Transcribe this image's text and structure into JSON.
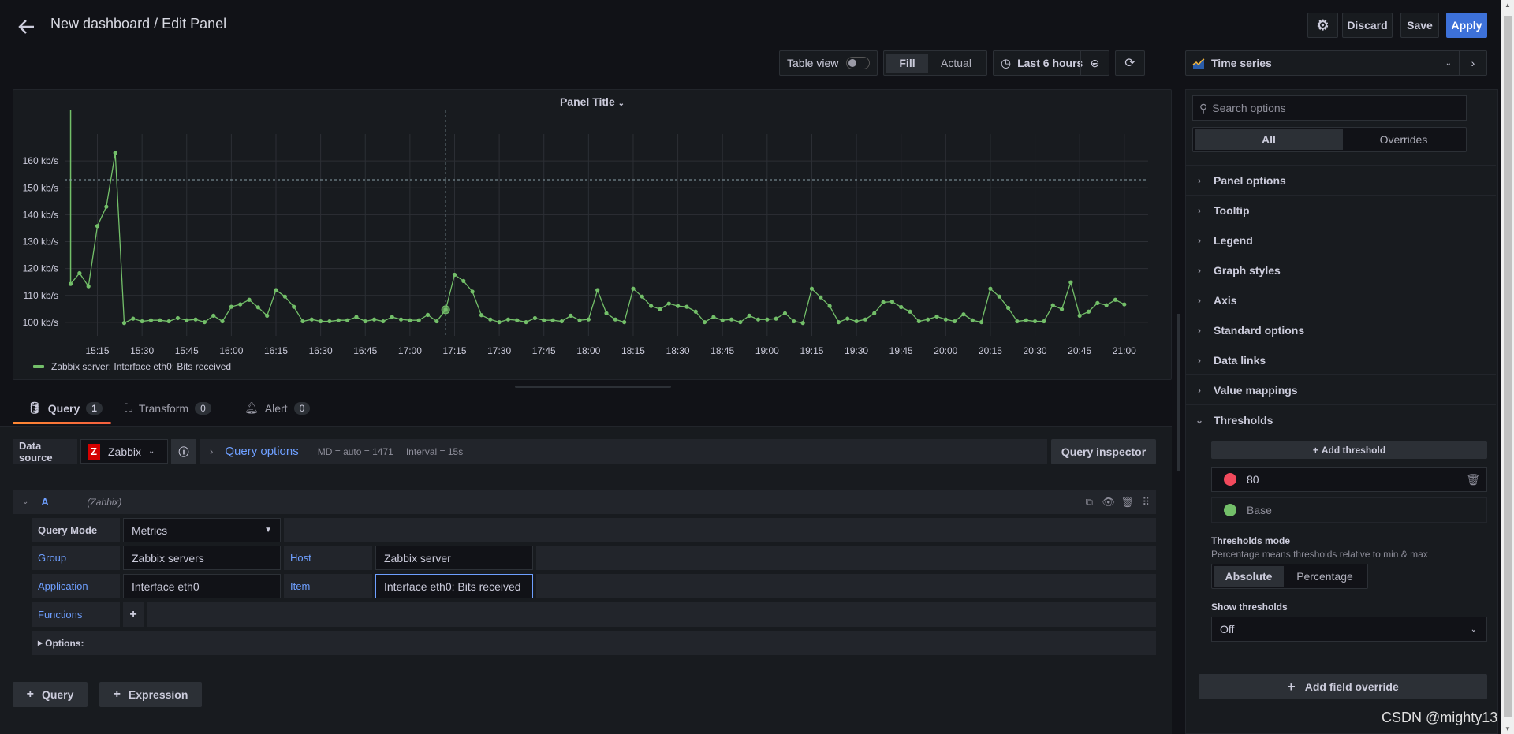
{
  "header": {
    "title": "New dashboard / Edit Panel",
    "discard": "Discard",
    "save": "Save",
    "apply": "Apply"
  },
  "toolbar": {
    "table_view": "Table view",
    "table_view_on": false,
    "fill": "Fill",
    "actual": "Actual",
    "time_range": "Last 6 hours",
    "visualization": "Time series"
  },
  "panel": {
    "title": "Panel Title",
    "legend": "Zabbix server: Interface eth0: Bits received"
  },
  "chart_data": {
    "type": "line",
    "ylim": [
      95,
      170
    ],
    "xlim": [
      "15:04",
      "21:08"
    ],
    "y_ticks": [
      "100 kb/s",
      "110 kb/s",
      "120 kb/s",
      "130 kb/s",
      "140 kb/s",
      "150 kb/s",
      "160 kb/s"
    ],
    "y_tick_values": [
      100,
      110,
      120,
      130,
      140,
      150,
      160
    ],
    "x_ticks": [
      "15:15",
      "15:30",
      "15:45",
      "16:00",
      "16:15",
      "16:30",
      "16:45",
      "17:00",
      "17:15",
      "17:30",
      "17:45",
      "18:00",
      "18:15",
      "18:30",
      "18:45",
      "19:00",
      "19:15",
      "19:30",
      "19:45",
      "20:00",
      "20:15",
      "20:30",
      "20:45",
      "21:00"
    ],
    "grid": true,
    "legend_placement": "bottom-left",
    "series_color": "#73bf69",
    "hover": {
      "x": "17:12",
      "y": 153
    },
    "series": [
      {
        "name": "Zabbix server: Interface eth0: Bits received",
        "unit": "kb/s",
        "points": [
          [
            "15:06",
            114.3
          ],
          [
            "15:09",
            118.3
          ],
          [
            "15:12",
            113.4
          ],
          [
            "15:15",
            135.8
          ],
          [
            "15:18",
            143
          ],
          [
            "15:21",
            163
          ],
          [
            "15:24",
            99.8
          ],
          [
            "15:27",
            101.4
          ],
          [
            "15:30",
            100.4
          ],
          [
            "15:33",
            100.8
          ],
          [
            "15:36",
            100.8
          ],
          [
            "15:39",
            100.4
          ],
          [
            "15:42",
            101.6
          ],
          [
            "15:45",
            100.8
          ],
          [
            "15:48",
            101.1
          ],
          [
            "15:51",
            100.1
          ],
          [
            "15:54",
            102.5
          ],
          [
            "15:57",
            100.4
          ],
          [
            "16:00",
            105.8
          ],
          [
            "16:03",
            106.7
          ],
          [
            "16:06",
            108.4
          ],
          [
            "16:09",
            105.6
          ],
          [
            "16:12",
            102.5
          ],
          [
            "16:15",
            112
          ],
          [
            "16:18",
            109.6
          ],
          [
            "16:21",
            105.8
          ],
          [
            "16:24",
            100.4
          ],
          [
            "16:27",
            101.1
          ],
          [
            "16:30",
            100.4
          ],
          [
            "16:33",
            100.4
          ],
          [
            "16:36",
            100.8
          ],
          [
            "16:39",
            100.8
          ],
          [
            "16:42",
            102
          ],
          [
            "16:45",
            100.4
          ],
          [
            "16:48",
            101.1
          ],
          [
            "16:51",
            100.4
          ],
          [
            "16:54",
            102
          ],
          [
            "16:57",
            101.1
          ],
          [
            "17:00",
            100.8
          ],
          [
            "17:03",
            100.8
          ],
          [
            "17:06",
            102.8
          ],
          [
            "17:09",
            100.4
          ],
          [
            "17:12",
            104.7
          ],
          [
            "17:15",
            117.7
          ],
          [
            "17:18",
            115.4
          ],
          [
            "17:21",
            111.4
          ],
          [
            "17:24",
            102.7
          ],
          [
            "17:27",
            101.1
          ],
          [
            "17:30",
            100.1
          ],
          [
            "17:33",
            101.1
          ],
          [
            "17:36",
            100.8
          ],
          [
            "17:39",
            100.1
          ],
          [
            "17:42",
            101.6
          ],
          [
            "17:45",
            100.8
          ],
          [
            "17:48",
            100.8
          ],
          [
            "17:51",
            100.4
          ],
          [
            "17:54",
            102.5
          ],
          [
            "17:57",
            100.8
          ],
          [
            "18:00",
            101.1
          ],
          [
            "18:03",
            112
          ],
          [
            "18:06",
            103.4
          ],
          [
            "18:09",
            101.1
          ],
          [
            "18:12",
            100.1
          ],
          [
            "18:15",
            112.5
          ],
          [
            "18:18",
            109.6
          ],
          [
            "18:21",
            106.1
          ],
          [
            "18:24",
            104.9
          ],
          [
            "18:27",
            107
          ],
          [
            "18:30",
            106.1
          ],
          [
            "18:33",
            105.8
          ],
          [
            "18:36",
            104
          ],
          [
            "18:39",
            100.1
          ],
          [
            "18:42",
            102
          ],
          [
            "18:45",
            100.8
          ],
          [
            "18:48",
            101.1
          ],
          [
            "18:51",
            100.1
          ],
          [
            "18:54",
            102.5
          ],
          [
            "18:57",
            101.1
          ],
          [
            "19:00",
            101.1
          ],
          [
            "19:03",
            101.4
          ],
          [
            "19:06",
            103.4
          ],
          [
            "19:09",
            100.4
          ],
          [
            "19:12",
            99.8
          ],
          [
            "19:15",
            112.5
          ],
          [
            "19:18",
            109.3
          ],
          [
            "19:21",
            106.1
          ],
          [
            "19:24",
            100.1
          ],
          [
            "19:27",
            101.4
          ],
          [
            "19:30",
            100.4
          ],
          [
            "19:33",
            101.1
          ],
          [
            "19:36",
            103.4
          ],
          [
            "19:39",
            107.5
          ],
          [
            "19:42",
            107.7
          ],
          [
            "19:45",
            105.7
          ],
          [
            "19:48",
            104
          ],
          [
            "19:51",
            100.4
          ],
          [
            "19:54",
            101.1
          ],
          [
            "19:57",
            102.2
          ],
          [
            "20:00",
            101.1
          ],
          [
            "20:03",
            100.4
          ],
          [
            "20:06",
            103
          ],
          [
            "20:09",
            100.8
          ],
          [
            "20:12",
            100.1
          ],
          [
            "20:15",
            112.5
          ],
          [
            "20:18",
            109.6
          ],
          [
            "20:21",
            105.4
          ],
          [
            "20:24",
            100.4
          ],
          [
            "20:27",
            100.8
          ],
          [
            "20:30",
            100.4
          ],
          [
            "20:33",
            100.4
          ],
          [
            "20:36",
            106.4
          ],
          [
            "20:39",
            104.9
          ],
          [
            "20:42",
            114.9
          ],
          [
            "20:45",
            102.5
          ],
          [
            "20:48",
            104
          ],
          [
            "20:51",
            107.2
          ],
          [
            "20:54",
            106.4
          ],
          [
            "20:57",
            108.4
          ],
          [
            "21:00",
            106.7
          ]
        ]
      }
    ]
  },
  "tabs": [
    {
      "label": "Query",
      "count": "1"
    },
    {
      "label": "Transform",
      "count": "0"
    },
    {
      "label": "Alert",
      "count": "0"
    }
  ],
  "query": {
    "datasource_label": "Data source",
    "datasource": "Zabbix",
    "query_options": "Query options",
    "md": "MD = auto = 1471",
    "interval": "Interval = 15s",
    "inspector": "Query inspector",
    "ref": "A",
    "ref_ds": "(Zabbix)",
    "mode_label": "Query Mode",
    "mode": "Metrics",
    "group_label": "Group",
    "group": "Zabbix servers",
    "host_label": "Host",
    "host": "Zabbix server",
    "app_label": "Application",
    "app": "Interface eth0",
    "item_label": "Item",
    "item": "Interface eth0: Bits received",
    "functions_label": "Functions",
    "options_label": "Options:",
    "add_query": "Query",
    "add_expression": "Expression"
  },
  "options": {
    "search_placeholder": "Search options",
    "tab_all": "All",
    "tab_overrides": "Overrides",
    "sections": [
      "Panel options",
      "Tooltip",
      "Legend",
      "Graph styles",
      "Axis",
      "Standard options",
      "Data links",
      "Value mappings"
    ],
    "thresholds": {
      "title": "Thresholds",
      "add": "Add threshold",
      "steps": [
        {
          "value": "80",
          "color": "#f2495c"
        },
        {
          "value": "Base",
          "color": "#73bf69"
        }
      ],
      "mode_label": "Thresholds mode",
      "mode_desc": "Percentage means thresholds relative to min & max",
      "mode_absolute": "Absolute",
      "mode_percentage": "Percentage",
      "mode_selected": "Absolute",
      "show_label": "Show thresholds",
      "show_value": "Off"
    },
    "add_override": "Add field override"
  },
  "watermark": "CSDN @mighty13",
  "colors": {
    "accent": "#3d71d9",
    "link": "#6e9fff",
    "series": "#73bf69",
    "tab_underline": "#f55f3e"
  }
}
